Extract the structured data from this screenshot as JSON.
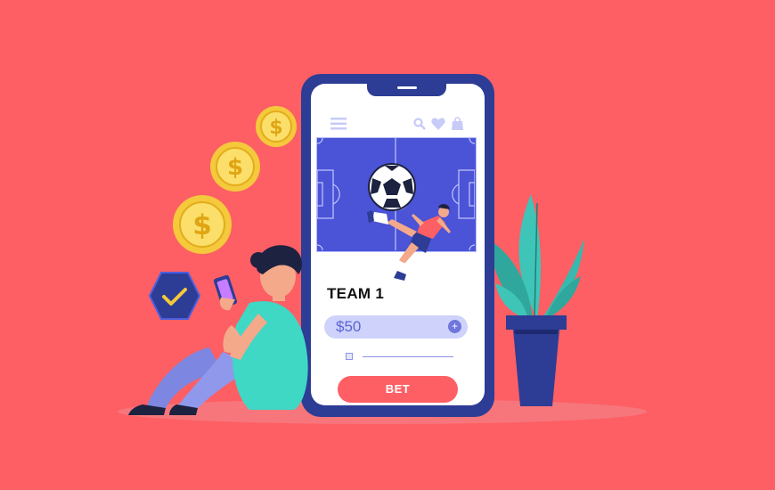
{
  "colors": {
    "background": "#fd5f64",
    "phone_frame": "#2d3c94",
    "field": "#4b53d6",
    "accent": "#fd5f64",
    "coin": "#f4c93c"
  },
  "icons": [
    "dollar-coin-icon",
    "check-badge-icon",
    "menu-icon",
    "search-icon",
    "heart-icon",
    "bag-icon",
    "plus-icon"
  ],
  "app": {
    "team_label": "TEAM 1",
    "bet_amount": "$50",
    "plus_symbol": "+",
    "bet_button_label": "BET"
  }
}
